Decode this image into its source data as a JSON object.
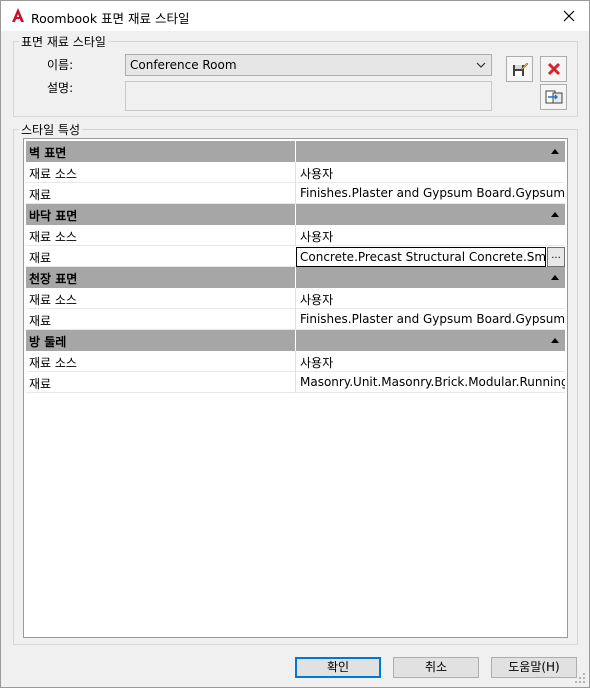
{
  "window": {
    "title": "Roombook 표면 재료 스타일",
    "close_glyph": "✕"
  },
  "surface_group": {
    "label": "표면 재료 스타일",
    "name_label": "이름:",
    "name_value": "Conference Room",
    "desc_label": "설명:",
    "desc_value": ""
  },
  "props_group": {
    "label": "스타일 특성",
    "categories": [
      {
        "name": "벽 표면",
        "rows": [
          {
            "key": "재료 소스",
            "value": "사용자"
          },
          {
            "key": "재료",
            "value": "Finishes.Plaster and Gypsum Board.Gypsum Wall"
          }
        ]
      },
      {
        "name": "바닥 표면",
        "rows": [
          {
            "key": "재료 소스",
            "value": "사용자"
          },
          {
            "key": "재료",
            "value": "Concrete.Precast Structural Concrete.Smooth",
            "ellipsis": "..."
          }
        ]
      },
      {
        "name": "천장 표면",
        "rows": [
          {
            "key": "재료 소스",
            "value": "사용자"
          },
          {
            "key": "재료",
            "value": "Finishes.Plaster and Gypsum Board.Gypsum Wall"
          }
        ]
      },
      {
        "name": "방 둘레",
        "rows": [
          {
            "key": "재료 소스",
            "value": "사용자"
          },
          {
            "key": "재료",
            "value": "Masonry.Unit.Masonry.Brick.Modular.Running"
          }
        ]
      }
    ]
  },
  "buttons": {
    "ok": "확인",
    "cancel": "취소",
    "help": "도움말(H)"
  },
  "colors": {
    "category_bg": "#a6a6a6",
    "default_button_border": "#0078d7",
    "delete_red": "#d9222a",
    "app_icon_red": "#c8102e"
  }
}
